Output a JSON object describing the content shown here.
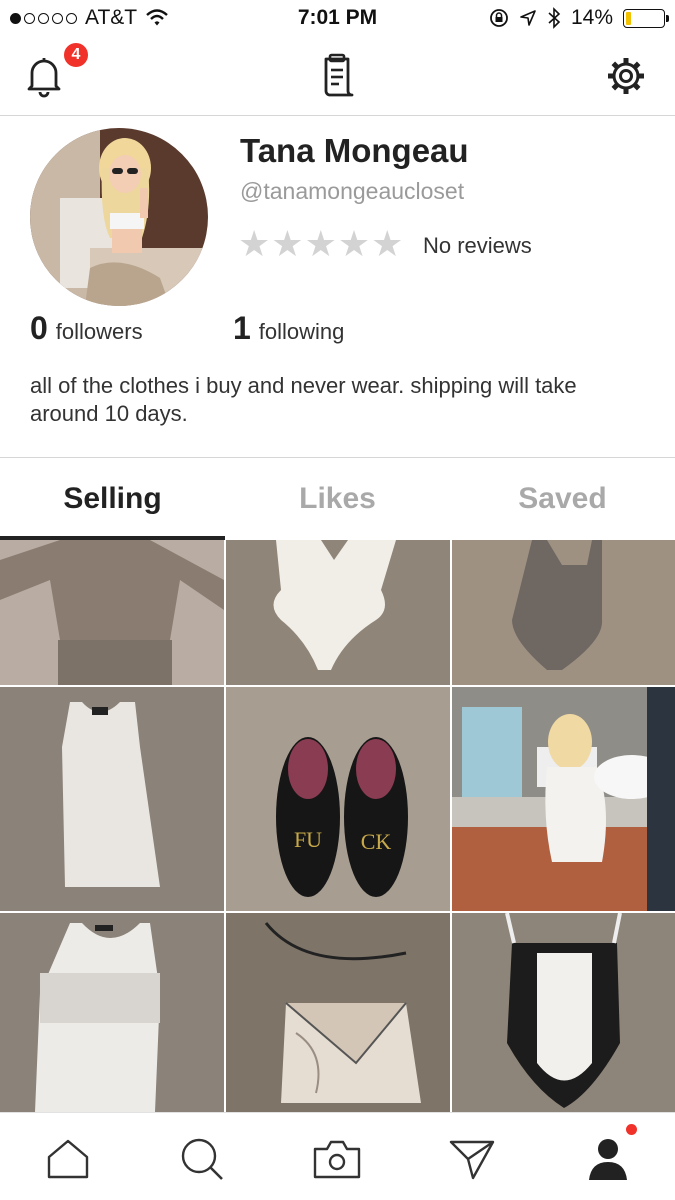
{
  "status_bar": {
    "carrier": "AT&T",
    "time": "7:01 PM",
    "battery_percent_text": "14%",
    "battery_level": 0.14,
    "battery_color": "#f2c200",
    "icons": [
      "signal-dots-icon",
      "wifi-icon",
      "rotation-lock-icon",
      "location-arrow-icon",
      "bluetooth-icon",
      "battery-icon"
    ]
  },
  "top_nav": {
    "notification_count": "4",
    "icons": [
      "bell-icon",
      "receipt-icon",
      "gear-icon"
    ],
    "badge_color": "#f0322b"
  },
  "profile": {
    "name": "Tana Mongeau",
    "handle": "@tanamongeaucloset",
    "rating_stars": 0,
    "rating_max": 5,
    "reviews_text": "No reviews",
    "followers_count": "0",
    "followers_label": "followers",
    "following_count": "1",
    "following_label": "following",
    "bio": "all of the clothes i buy and never wear. shipping will take around 10 days."
  },
  "tabs": [
    {
      "label": "Selling",
      "active": true
    },
    {
      "label": "Likes",
      "active": false
    },
    {
      "label": "Saved",
      "active": false
    }
  ],
  "listings": [
    {
      "item": "grey velour long-sleeve dress"
    },
    {
      "item": "white bodysuit"
    },
    {
      "item": "grey bodysuit"
    },
    {
      "item": "white textured mini dress"
    },
    {
      "item": "black loafers",
      "left_shoe_text": "FU",
      "right_shoe_text": "CK"
    },
    {
      "item": "white off-shoulder dress photo"
    },
    {
      "item": "white mesh panel bodysuit"
    },
    {
      "item": "marble clutch bag"
    },
    {
      "item": "black and white bodysuit"
    }
  ],
  "bottom_nav": {
    "items": [
      "home-icon",
      "search-icon",
      "camera-icon",
      "send-icon",
      "profile-icon"
    ],
    "profile_dot_color": "#f0322b"
  }
}
